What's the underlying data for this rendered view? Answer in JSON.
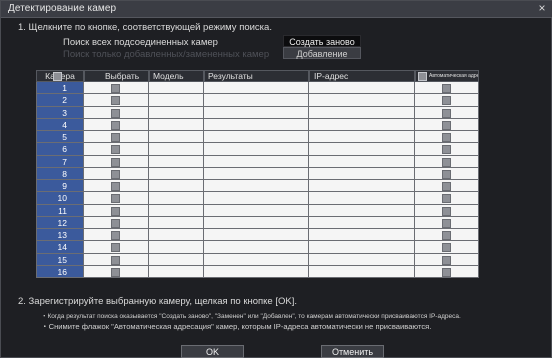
{
  "window": {
    "title": "Детектирование камер",
    "close_glyph": "×"
  },
  "step1": {
    "instruction": "1. Щелкните по кнопке, соответствующей режиму поиска.",
    "search_all_label": "Поиск всех подсоединенных камер",
    "search_new_label": "Поиск только добавленных/замененных камер",
    "recreate_button": "Создать заново",
    "add_button": "Добавление"
  },
  "table": {
    "headers": {
      "camera": "Камера",
      "select": "Выбрать",
      "model": "Модель",
      "results": "Результаты",
      "ip": "IP-адрес",
      "auto": "Автоматическая адресация"
    },
    "rows": [
      "1",
      "2",
      "3",
      "4",
      "5",
      "6",
      "7",
      "8",
      "9",
      "10",
      "11",
      "12",
      "13",
      "14",
      "15",
      "16"
    ]
  },
  "step2": {
    "instruction": "2. Зарегистрируйте выбранную камеру, щелкая по кнопке [OK].",
    "note1": "・Когда результат поиска оказывается \"Создать заново\", \"Заменен\" или \"Добавлен\", то камерам автоматически присваиваются IP-адреса.",
    "note2": "・Снимите флажок \"Автоматическая адресация\" камер, которым IP-адреса автоматически не присваиваются."
  },
  "footer": {
    "ok_label": "OK",
    "cancel_label": "Отменить"
  },
  "colors": {
    "camera_cell": "#3b5a9c",
    "background": "#1e1f23",
    "titlebar": "#3b3d44"
  }
}
